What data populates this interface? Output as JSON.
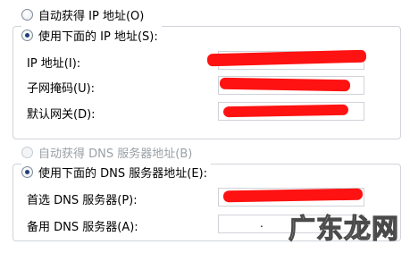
{
  "ip_section": {
    "auto_option": "自动获得 IP 地址(O)",
    "manual_option": "使用下面的 IP 地址(S):",
    "fields": [
      {
        "label": "IP 地址(I):",
        "value": ""
      },
      {
        "label": "子网掩码(U):",
        "value": ""
      },
      {
        "label": "默认网关(D):",
        "value": ""
      }
    ]
  },
  "dns_section": {
    "auto_option": "自动获得 DNS 服务器地址(B)",
    "manual_option": "使用下面的 DNS 服务器地址(E):",
    "fields": [
      {
        "label": "首选 DNS 服务器(P):",
        "value": ""
      },
      {
        "label": "备用 DNS 服务器(A):",
        "value": "."
      }
    ]
  },
  "watermark": "广东龙网",
  "colors": {
    "redaction": "#ff1212",
    "radio_dot": "#1f3f78",
    "group_border": "#d0d4da"
  }
}
